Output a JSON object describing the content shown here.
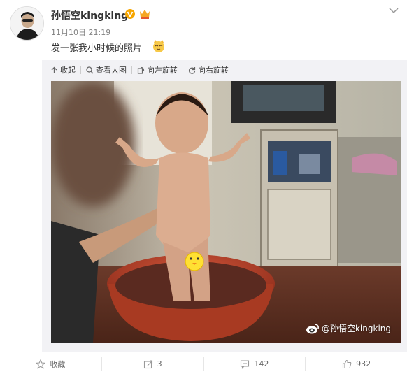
{
  "user": {
    "name": "孙悟空kingking",
    "timestamp": "11月10日 21:19"
  },
  "post": {
    "text": "发一张我小时候的照片"
  },
  "toolbar": {
    "collapse": "收起",
    "view_large": "查看大图",
    "rotate_left": "向左旋转",
    "rotate_right": "向右旋转"
  },
  "photo": {
    "watermark": "@孙悟空kingking"
  },
  "actions": {
    "favorite": "收藏",
    "repost": "3",
    "comment": "142",
    "like": "932"
  },
  "colors": {
    "accent": "#f7a600",
    "muted": "#808080",
    "panel": "#f2f2f5"
  },
  "icons": [
    "avatar",
    "verified-v-icon",
    "crown-badge-icon",
    "cat-emoji-icon",
    "chevron-down-icon",
    "collapse-icon",
    "zoom-icon",
    "rotate-left-icon",
    "rotate-right-icon",
    "weibo-logo-icon",
    "star-icon",
    "repost-icon",
    "comment-icon",
    "like-icon"
  ]
}
